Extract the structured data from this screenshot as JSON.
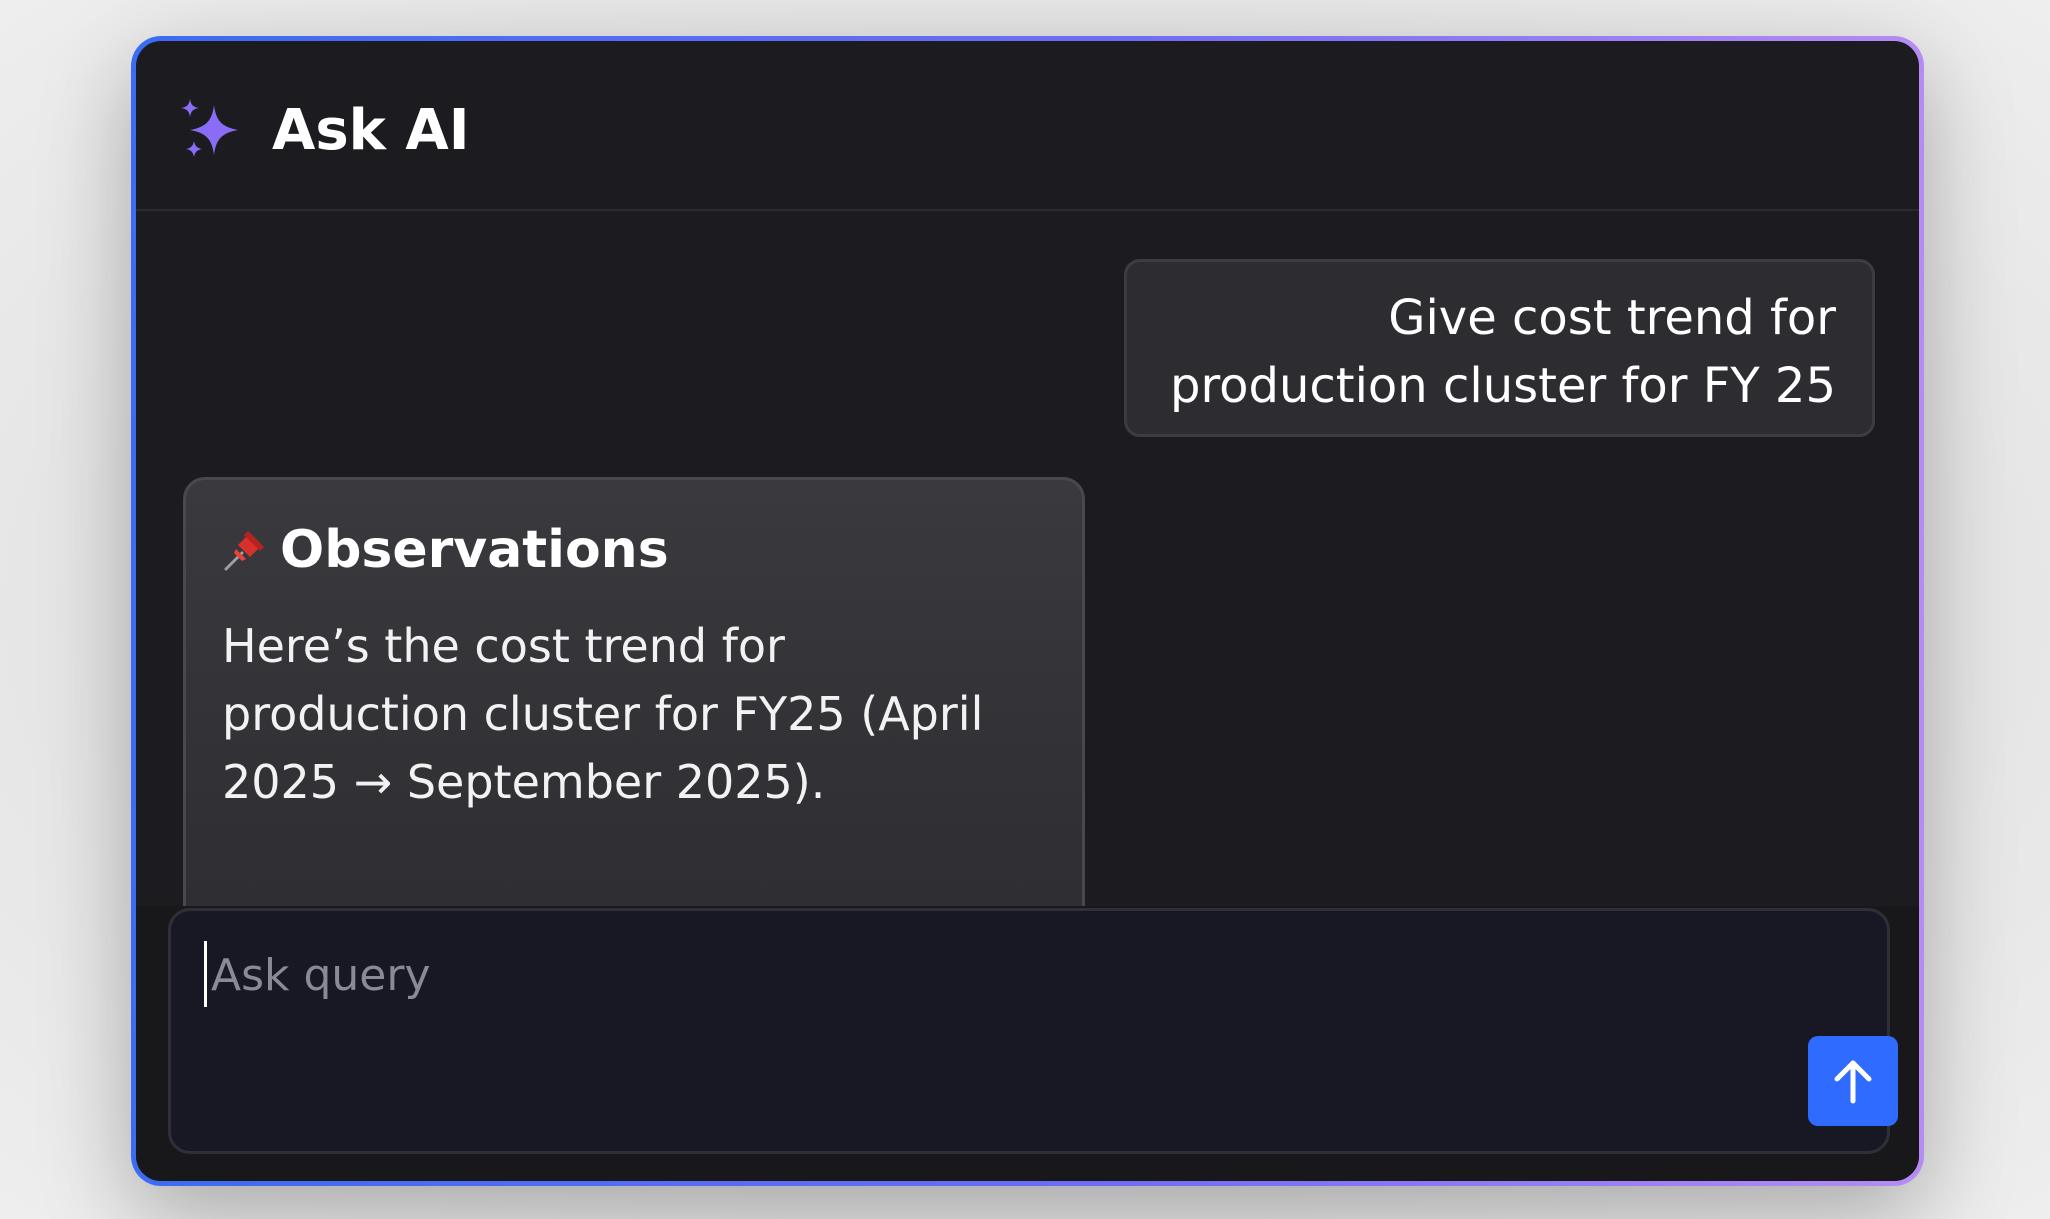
{
  "header": {
    "title": "Ask AI",
    "icon": "sparkle-icon",
    "icon_color": "#8b6cf6"
  },
  "conversation": {
    "user_message": "Give cost trend for production cluster for FY 25",
    "ai_response": {
      "heading_icon": "pushpin-icon",
      "heading": "Observations",
      "text": "Here’s the cost trend for production cluster for FY25 (April 2025 → September 2025)."
    }
  },
  "composer": {
    "placeholder": "Ask query",
    "value": "",
    "send_icon": "arrow-up-icon",
    "send_color": "#2f6bff"
  },
  "theme": {
    "border_gradient": [
      "#3b6cf2",
      "#b58cf3"
    ],
    "panel_bg": "#1c1c20"
  }
}
